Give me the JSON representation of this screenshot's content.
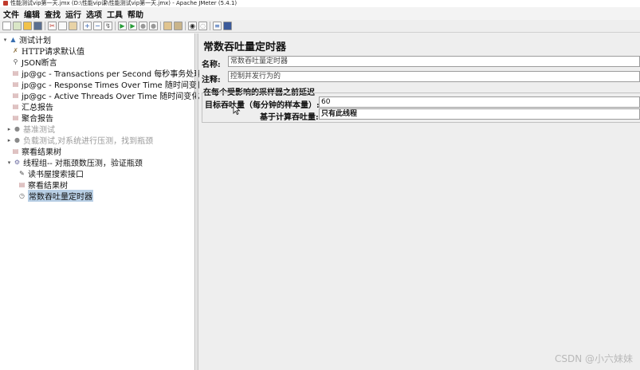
{
  "window": {
    "title": "性能测试vip第一天.jmx (D:\\性能vip课\\性能测试vip第一天.jmx) - Apache JMeter (5.4.1)"
  },
  "menubar": {
    "items": [
      "文件",
      "编辑",
      "查找",
      "运行",
      "选项",
      "工具",
      "帮助"
    ]
  },
  "toolbar": {
    "icons": [
      "new-icon",
      "templates-icon",
      "open-icon",
      "save-icon",
      "cut-icon",
      "copy-icon",
      "paste-icon",
      "expand-icon",
      "collapse-icon",
      "toggle-icon",
      "start-icon",
      "start-no-pause-icon",
      "stop-icon",
      "shutdown-icon",
      "clear-icon",
      "clear-all-icon",
      "search-icon",
      "reset-search-icon",
      "function-helper-icon",
      "help-icon"
    ]
  },
  "tree": {
    "items": [
      {
        "label": "测试计划",
        "icon": "test-plan-icon",
        "expander": "expanded"
      },
      {
        "label": "HTTP请求默认值",
        "icon": "wrench-icon"
      },
      {
        "label": "JSON断言",
        "icon": "magnifier-icon"
      },
      {
        "label": "jp@gc - Transactions per Second 每秒事务处理量",
        "icon": "graph-icon"
      },
      {
        "label": "jp@gc - Response Times Over Time 随时间变化响",
        "icon": "graph-icon"
      },
      {
        "label": "jp@gc - Active Threads Over Time 随时间变化的活",
        "icon": "graph-icon"
      },
      {
        "label": "汇总报告",
        "icon": "report-icon"
      },
      {
        "label": "聚合报告",
        "icon": "report-icon"
      },
      {
        "label": "基准测试",
        "icon": "thread-group-icon",
        "expander": "collapsed",
        "disabled": true
      },
      {
        "label": "负载测试,对系统进行压测，找到瓶颈",
        "icon": "thread-group-icon",
        "expander": "collapsed",
        "disabled": true
      },
      {
        "label": "察看结果树",
        "icon": "report-icon"
      },
      {
        "label": "线程组-- 对瓶颈数压测，验证瓶颈",
        "icon": "thread-group-icon",
        "expander": "expanded"
      },
      {
        "label": "读书屋搜索接口",
        "icon": "pencil-icon"
      },
      {
        "label": "察看结果树",
        "icon": "report-icon"
      },
      {
        "label": "常数吞吐量定时器",
        "icon": "timer-icon",
        "selected": true
      }
    ]
  },
  "panel": {
    "title": "常数吞吐量定时器",
    "name_label": "名称:",
    "name_value": "常数吞吐量定时器",
    "comment_label": "注释:",
    "comment_value": "控制并发行为的",
    "group_title": "在每个受影响的采样器之前延迟",
    "target_label": "目标吞吐量（每分钟的样本量）:",
    "target_value": "60",
    "calc_label": "基于计算吞吐量:",
    "calc_value": "只有此线程"
  },
  "watermark": "CSDN @小六妹妹"
}
